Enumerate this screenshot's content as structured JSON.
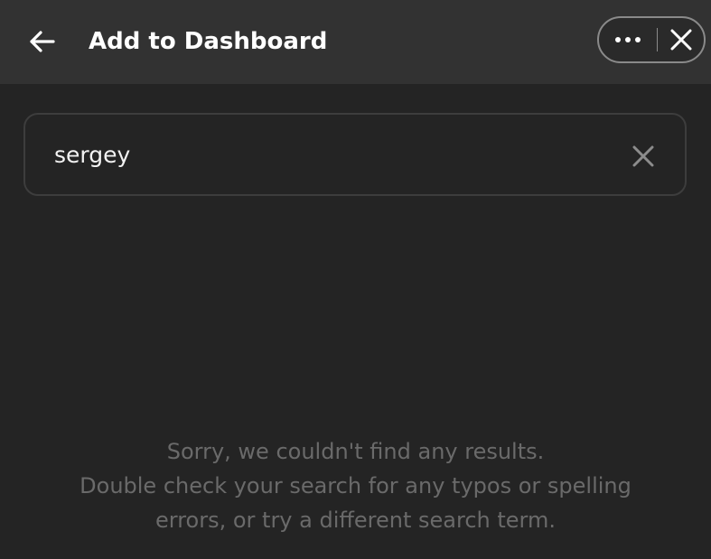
{
  "header": {
    "title": "Add to Dashboard",
    "back_icon": "arrow-left-icon",
    "more_icon": "more-horizontal-icon",
    "close_icon": "close-icon"
  },
  "search": {
    "value": "sergey",
    "clear_icon": "close-icon"
  },
  "empty_state": {
    "line1": "Sorry, we couldn't find any results.",
    "line2": "Double check your search for any typos or spelling",
    "line3": "errors, or try a different search term."
  },
  "colors": {
    "background": "#242424",
    "header_background": "#323232",
    "title_text": "#ffffff",
    "muted_text": "#6a6a6a",
    "border": "#3d3d3d"
  }
}
